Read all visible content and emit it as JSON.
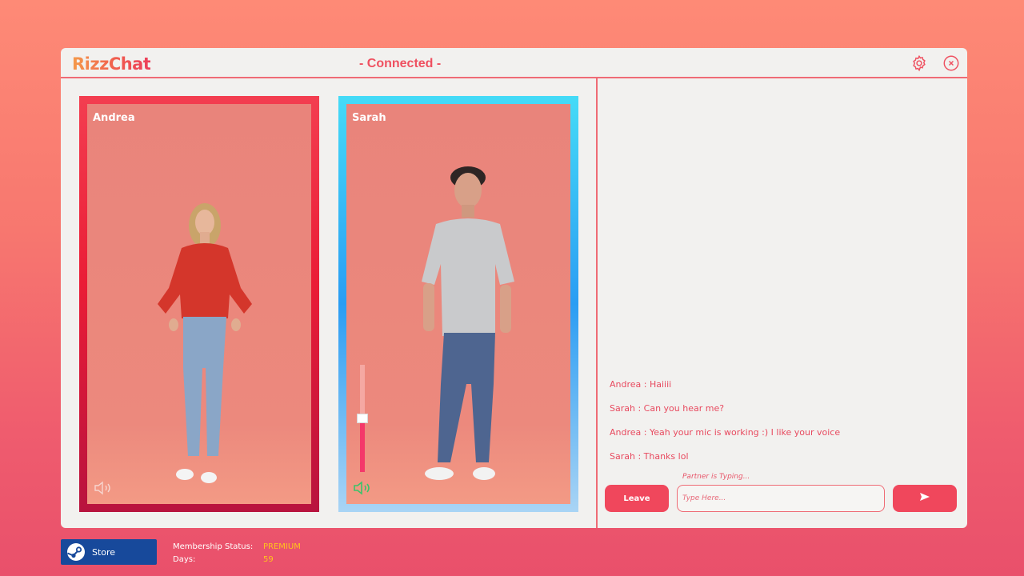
{
  "app": {
    "logo": "RizzChat",
    "status": "- Connected -",
    "settings_icon": "gear-icon",
    "close_icon": "close-icon"
  },
  "videos": [
    {
      "name": "Andrea",
      "speaker_icon": "speaker-icon"
    },
    {
      "name": "Sarah",
      "speaker_icon": "speaker-icon",
      "volume": 0.5
    }
  ],
  "chat": {
    "messages": [
      "Andrea : Haiiii",
      "Sarah : Can you hear me?",
      "Andrea : Yeah your mic is working :) I like your voice",
      "Sarah : Thanks lol"
    ],
    "typing_indicator": "Partner is Typing...",
    "leave_label": "Leave",
    "input_placeholder": "Type Here...",
    "send_icon": "send-icon"
  },
  "footer": {
    "store_label": "Store",
    "store_icon": "steam-icon",
    "membership_label": "Membership Status:",
    "membership_value": "PREMIUM",
    "days_label": "Days:",
    "days_value": "59"
  },
  "colors": {
    "accent": "#f0475c",
    "andrea_frame": "#ea1d36",
    "sarah_frame": "#2a9df3",
    "premium": "#ffc21e",
    "store_bg": "#17499b"
  }
}
